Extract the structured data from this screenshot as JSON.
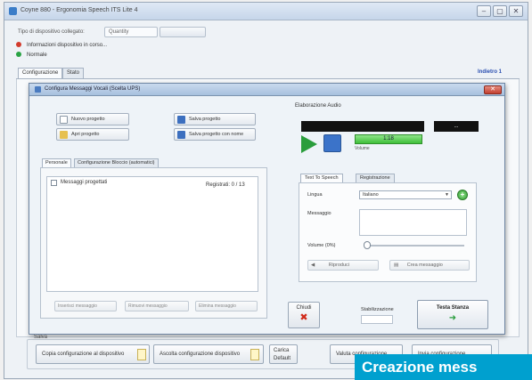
{
  "window": {
    "title": "Coyne 880 - Ergonomia Speech ITS Lite 4",
    "toolbar_label": "Tipo di dispositivo collegato:",
    "toolbar_field": "Quantity"
  },
  "status": {
    "line1": "Informazioni dispositivo in corso...",
    "line2": "Normale",
    "line1_color": "#d23b2c",
    "line2_color": "#2aa345"
  },
  "main_tabs": [
    {
      "label": "Configurazione"
    },
    {
      "label": "Stato"
    }
  ],
  "top_right_link": "Indietro 1",
  "dialog": {
    "title": "Configura Messaggi Vocali (Scelta UPS)",
    "close_icon": "close-x",
    "buttons": {
      "new_project": "Nuovo progetto",
      "save_project": "Salva progetto",
      "open_project": "Apri progetto",
      "save_project_as": "Salva progetto con nome"
    },
    "preview": {
      "label": "Elaborazione Audio",
      "time_label": "...",
      "volume_value": "1:18",
      "volume_caption": "Volume"
    },
    "inner_tabs": [
      {
        "label": "Personale"
      },
      {
        "label": "Configurazione Bloccio (automatici)"
      }
    ],
    "list": {
      "header_label": "Messaggi progettati",
      "count_label": "Registrati: 0 / 13"
    },
    "footer_buttons": [
      {
        "label": "Inserisci messaggio"
      },
      {
        "label": "Rimuovi messaggio"
      },
      {
        "label": "Elimina messaggio"
      }
    ],
    "tts": {
      "tabs": [
        {
          "label": "Text To Speech"
        },
        {
          "label": "Registrazione"
        }
      ],
      "language_label": "Lingua",
      "language_value": "Italiano",
      "message_label": "Messaggio",
      "volume_label": "Volume (0%)",
      "btn_play": "Riproduci",
      "btn_create": "Crea messaggio"
    },
    "close_button_label": "Chiudi",
    "priority_label": "Stabilizzazione",
    "test_button_label": "Testa Stanza"
  },
  "bottom_group": {
    "label": "Salva",
    "buttons": [
      {
        "label": "Copia configurazione al dispositivo"
      },
      {
        "label": "Ascolta configurazione dispositivo"
      },
      {
        "label": "Carica Default"
      },
      {
        "label": "Valuta configurazione"
      },
      {
        "label": "Invia configurazione"
      }
    ]
  },
  "caption": "Creazione mess"
}
